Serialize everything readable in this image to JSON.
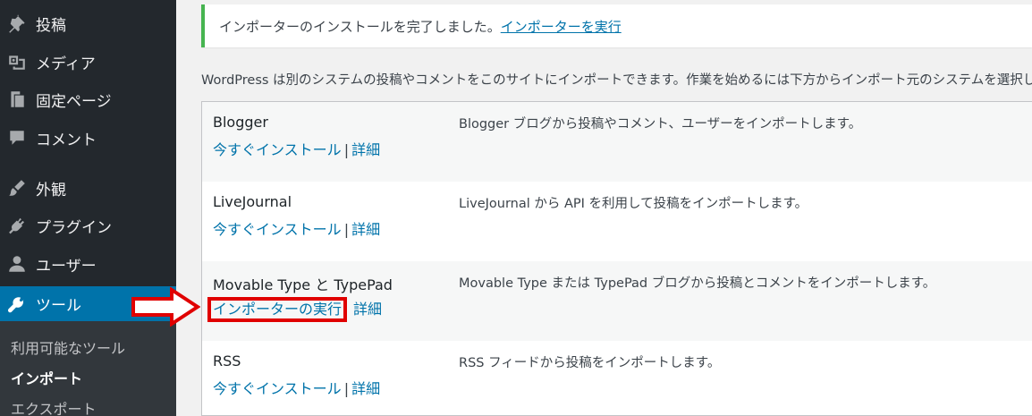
{
  "sidebar": {
    "items": [
      {
        "label": "投稿",
        "icon": "pushpin-icon"
      },
      {
        "label": "メディア",
        "icon": "media-icon"
      },
      {
        "label": "固定ページ",
        "icon": "page-icon"
      },
      {
        "label": "コメント",
        "icon": "comment-icon"
      },
      {
        "label": "外観",
        "icon": "brush-icon"
      },
      {
        "label": "プラグイン",
        "icon": "plugin-icon"
      },
      {
        "label": "ユーザー",
        "icon": "user-icon"
      },
      {
        "label": "ツール",
        "icon": "wrench-icon"
      }
    ],
    "submenu": [
      {
        "label": "利用可能なツール"
      },
      {
        "label": "インポート"
      },
      {
        "label": "エクスポート"
      }
    ]
  },
  "notice": {
    "text": "インポーターのインストールを完了しました。",
    "link": "インポーターを実行"
  },
  "intro": "WordPress は別のシステムの投稿やコメントをこのサイトにインポートできます。作業を始めるには下方からインポート元のシステムを選択してください。",
  "importers": [
    {
      "name": "Blogger",
      "action": "今すぐインストール",
      "sep": "|",
      "details": "詳細",
      "desc": "Blogger ブログから投稿やコメント、ユーザーをインポートします。"
    },
    {
      "name": "LiveJournal",
      "action": "今すぐインストール",
      "sep": "|",
      "details": "詳細",
      "desc": "LiveJournal から API を利用して投稿をインポートします。"
    },
    {
      "name": "Movable Type と TypePad",
      "action": "インポーターの実行",
      "sep": "|",
      "details": "詳細",
      "desc": "Movable Type または TypePad ブログから投稿とコメントをインポートします。"
    },
    {
      "name": "RSS",
      "action": "今すぐインストール",
      "sep": "|",
      "details": "詳細",
      "desc": "RSS フィードから投稿をインポートします。"
    }
  ],
  "colors": {
    "sidebar_bg": "#23282d",
    "active_bg": "#0073aa",
    "link": "#0073aa",
    "notice_border": "#46b450",
    "highlight": "#e00000"
  }
}
